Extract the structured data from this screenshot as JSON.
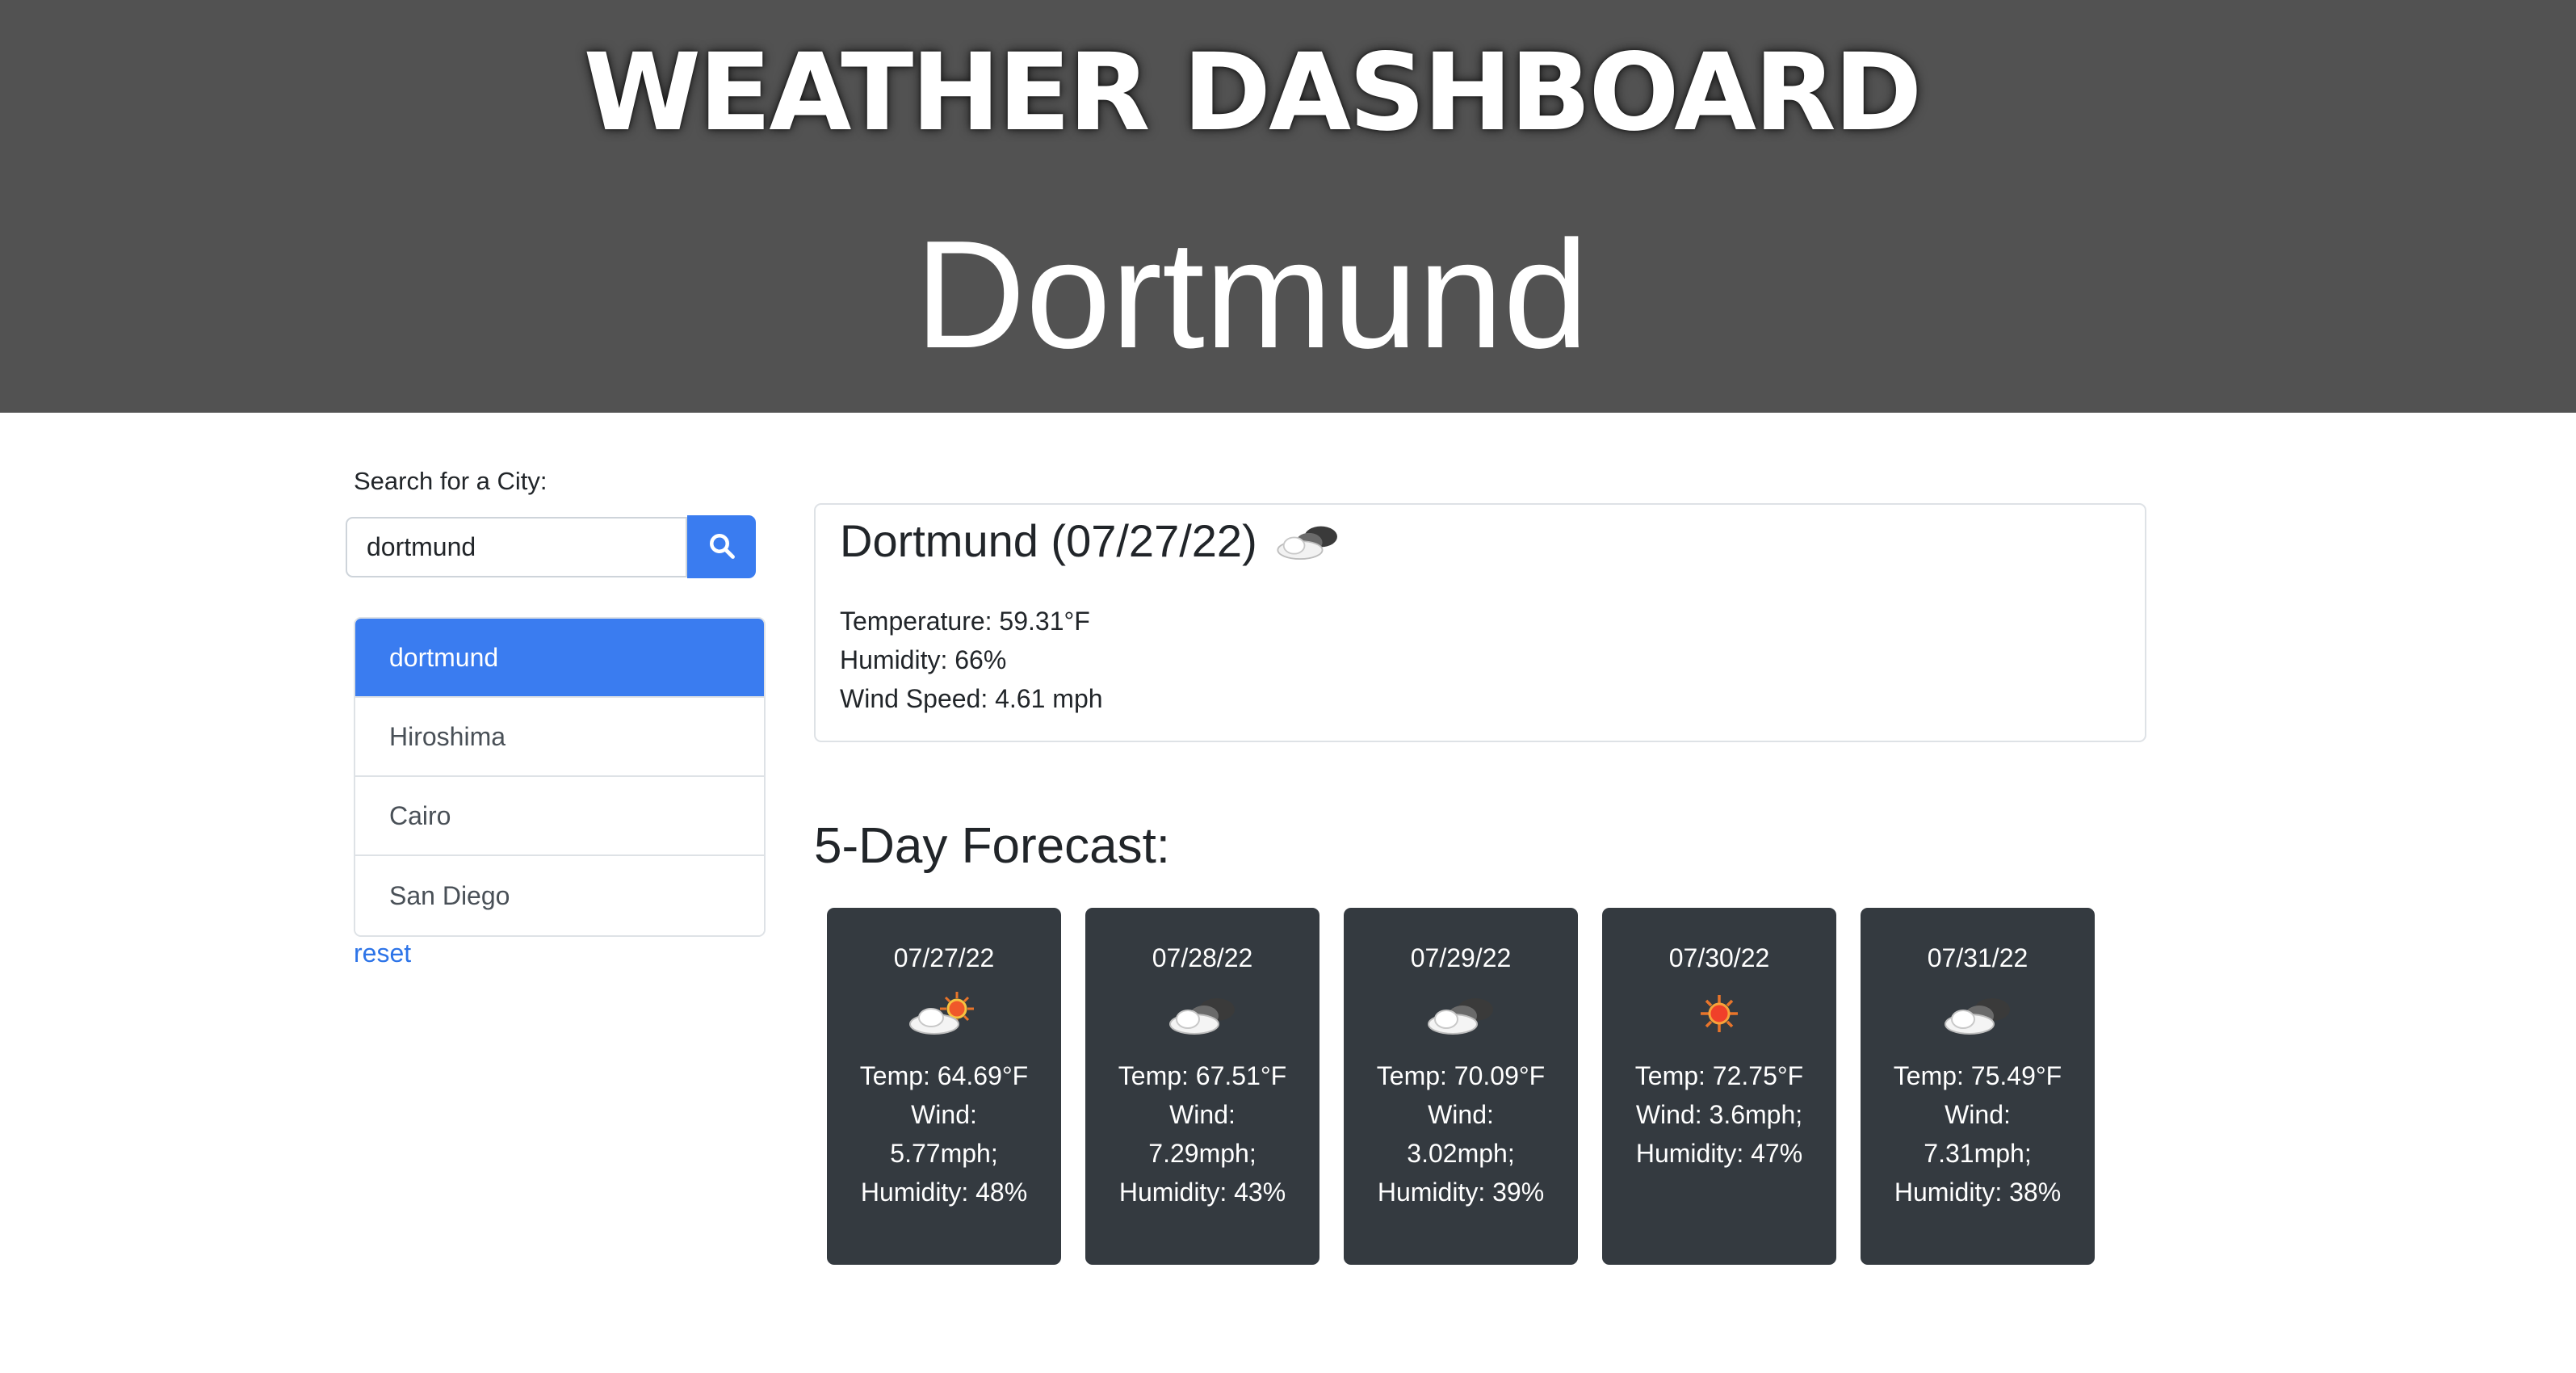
{
  "header": {
    "title": "WEATHER DASHBOARD",
    "city": "Dortmund"
  },
  "search": {
    "label": "Search for a City:",
    "value": "dortmund",
    "button_icon": "search-icon"
  },
  "history": {
    "items": [
      {
        "label": "dortmund",
        "active": true
      },
      {
        "label": "Hiroshima",
        "active": false
      },
      {
        "label": "Cairo",
        "active": false
      },
      {
        "label": "San Diego",
        "active": false
      }
    ],
    "reset_label": "reset"
  },
  "current": {
    "title": "Dortmund (07/27/22)",
    "icon": "cloudy-icon",
    "temperature": "Temperature: 59.31°F",
    "humidity": "Humidity: 66%",
    "wind": "Wind Speed: 4.61 mph"
  },
  "forecast": {
    "heading": "5-Day Forecast:",
    "days": [
      {
        "date": "07/27/22",
        "icon": "partly-sunny-icon",
        "temp": "Temp: 64.69°F",
        "wind_label": "Wind:",
        "wind_value": "5.77mph;",
        "humidity": "Humidity: 48%"
      },
      {
        "date": "07/28/22",
        "icon": "cloudy-icon",
        "temp": "Temp: 67.51°F",
        "wind_label": "Wind:",
        "wind_value": "7.29mph;",
        "humidity": "Humidity: 43%"
      },
      {
        "date": "07/29/22",
        "icon": "cloudy-icon",
        "temp": "Temp: 70.09°F",
        "wind_label": "Wind:",
        "wind_value": "3.02mph;",
        "humidity": "Humidity: 39%"
      },
      {
        "date": "07/30/22",
        "icon": "sunny-icon",
        "temp": "Temp: 72.75°F",
        "wind_label": "Wind: 3.6mph;",
        "wind_value": "Humidity: 47%",
        "humidity": ""
      },
      {
        "date": "07/31/22",
        "icon": "cloudy-icon",
        "temp": "Temp: 75.49°F",
        "wind_label": "Wind:",
        "wind_value": "7.31mph;",
        "humidity": "Humidity: 38%"
      }
    ]
  },
  "colors": {
    "header_bg": "#525252",
    "accent": "#3a7cf0",
    "card_dark": "#343a40"
  }
}
